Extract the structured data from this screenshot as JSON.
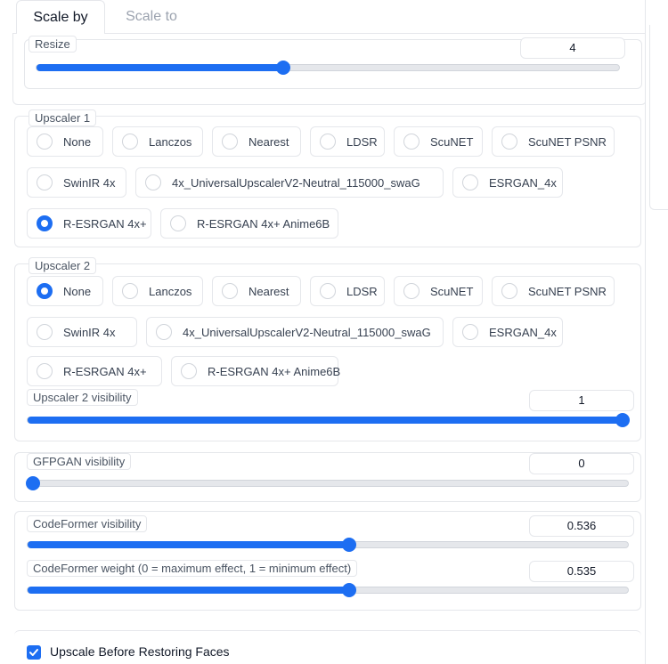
{
  "tabs": [
    {
      "label": "Scale by",
      "active": true
    },
    {
      "label": "Scale to",
      "active": false
    }
  ],
  "resize": {
    "label": "Resize",
    "value": "4",
    "fraction": 0.4236
  },
  "upscaler1": {
    "label": "Upscaler 1",
    "selected": "R-ESRGAN 4x+",
    "options": [
      "None",
      "Lanczos",
      "Nearest",
      "LDSR",
      "ScuNET",
      "ScuNET PSNR",
      "SwinIR 4x",
      "4x_UniversalUpscalerV2-Neutral_115000_swaG",
      "ESRGAN_4x",
      "R-ESRGAN 4x+",
      "R-ESRGAN 4x+ Anime6B"
    ]
  },
  "upscaler2": {
    "label": "Upscaler 2",
    "selected": "None",
    "options": [
      "None",
      "Lanczos",
      "Nearest",
      "LDSR",
      "ScuNET",
      "ScuNET PSNR",
      "SwinIR 4x",
      "4x_UniversalUpscalerV2-Neutral_115000_swaG",
      "ESRGAN_4x",
      "R-ESRGAN 4x+",
      "R-ESRGAN 4x+ Anime6B"
    ]
  },
  "upscaler2_visibility": {
    "label": "Upscaler 2 visibility",
    "value": "1",
    "fraction": 1.0
  },
  "gfpgan_visibility": {
    "label": "GFPGAN visibility",
    "value": "0",
    "fraction": 0.0
  },
  "codeformer_visibility": {
    "label": "CodeFormer visibility",
    "value": "0.536",
    "fraction": 0.536
  },
  "codeformer_weight": {
    "label": "CodeFormer weight (0 = maximum effect, 1 = minimum effect)",
    "value": "0.535",
    "fraction": 0.535
  },
  "upscale_before_restoring": {
    "label": "Upscale Before Restoring Faces",
    "checked": true
  },
  "colors": {
    "accent": "#1d6ef2",
    "border": "#e5e7eb"
  }
}
